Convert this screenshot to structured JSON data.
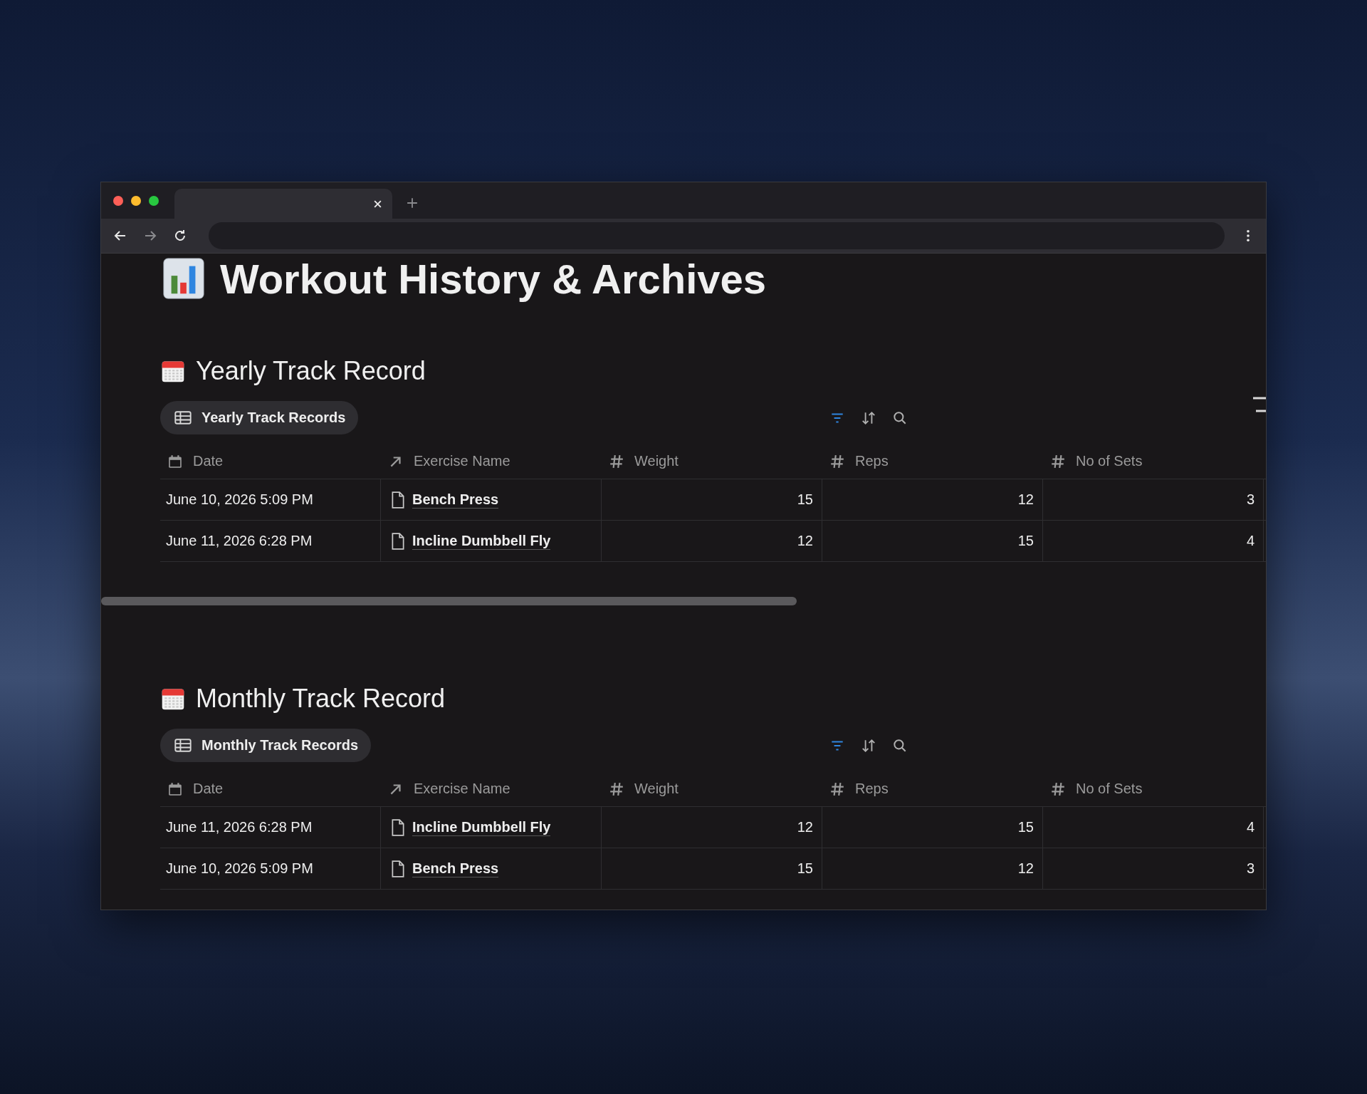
{
  "page": {
    "title": "Workout History & Archives"
  },
  "sections": [
    {
      "heading": "Yearly Track Record",
      "view": {
        "label": "Yearly Track Records",
        "selected": true
      },
      "filter_active": true,
      "scrollbar": true,
      "columns": [
        {
          "label": "Date",
          "kind": "date"
        },
        {
          "label": "Exercise Name",
          "kind": "relation"
        },
        {
          "label": "Weight",
          "kind": "number"
        },
        {
          "label": "Reps",
          "kind": "number"
        },
        {
          "label": "No of Sets",
          "kind": "number"
        }
      ],
      "rows": [
        {
          "cells": [
            "June 10, 2026 5:09 PM",
            "Bench Press",
            "15",
            "12",
            "3"
          ]
        },
        {
          "cells": [
            "June 11, 2026 6:28 PM",
            "Incline Dumbbell Fly",
            "12",
            "15",
            "4"
          ]
        }
      ]
    },
    {
      "heading": "Monthly Track Record",
      "view": {
        "label": "Monthly Track Records",
        "selected": true
      },
      "filter_active": true,
      "columns": [
        {
          "label": "Date",
          "kind": "date"
        },
        {
          "label": "Exercise Name",
          "kind": "relation"
        },
        {
          "label": "Weight",
          "kind": "number"
        },
        {
          "label": "Reps",
          "kind": "number"
        },
        {
          "label": "No of Sets",
          "kind": "number"
        }
      ],
      "rows": [
        {
          "cells": [
            "June 11, 2026 6:28 PM",
            "Incline Dumbbell Fly",
            "12",
            "15",
            "4"
          ]
        },
        {
          "cells": [
            "June 10, 2026 5:09 PM",
            "Bench Press",
            "15",
            "12",
            "3"
          ]
        }
      ]
    }
  ]
}
